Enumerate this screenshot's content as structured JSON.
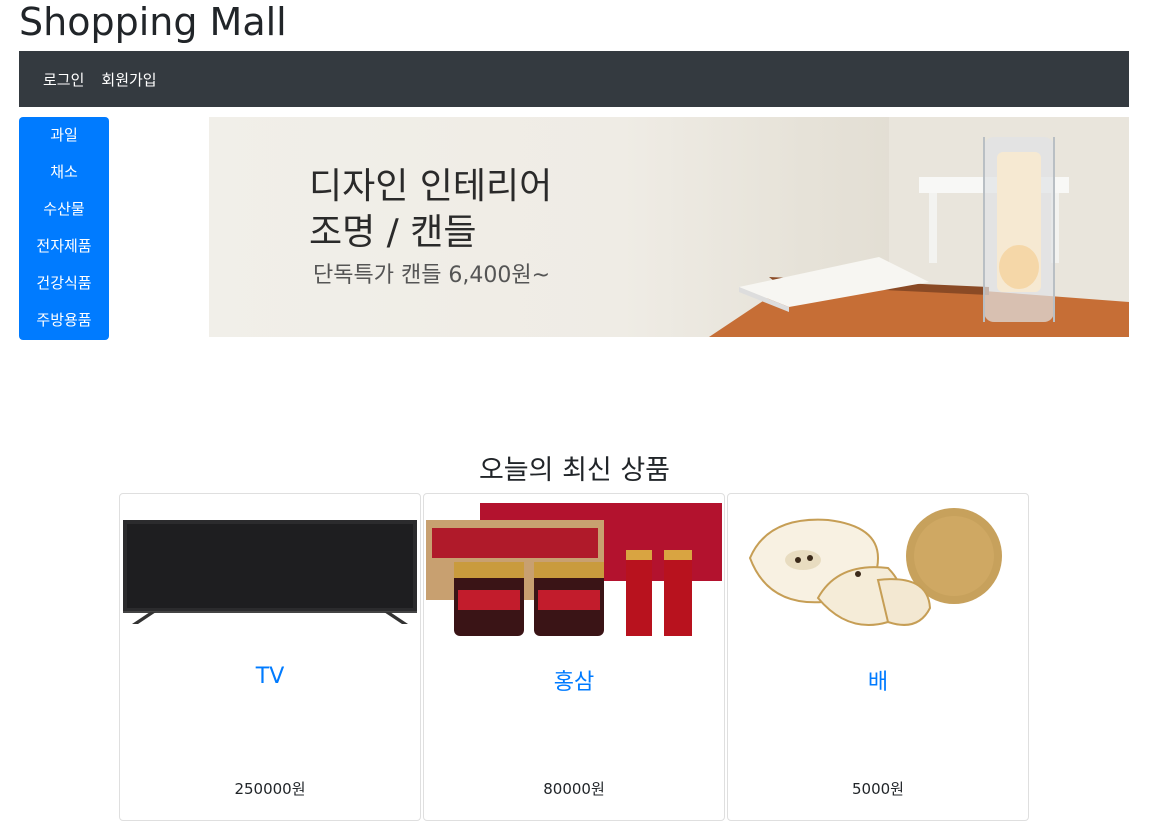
{
  "header": {
    "title": "Shopping Mall"
  },
  "nav": {
    "login": "로그인",
    "signup": "회원가입"
  },
  "categories": [
    "과일",
    "채소",
    "수산물",
    "전자제품",
    "건강식품",
    "주방용품"
  ],
  "banner": {
    "line1": "디자인 인테리어",
    "line2": "조명 / 캔들",
    "line3": "단독특가 캔들 6,400원~"
  },
  "section": {
    "title": "오늘의 최신 상품"
  },
  "products": [
    {
      "name": "TV",
      "price": "250000원"
    },
    {
      "name": "홍삼",
      "price": "80000원"
    },
    {
      "name": "배",
      "price": "5000원"
    }
  ],
  "colors": {
    "navbar": "#343a40",
    "accent": "#007bff"
  }
}
